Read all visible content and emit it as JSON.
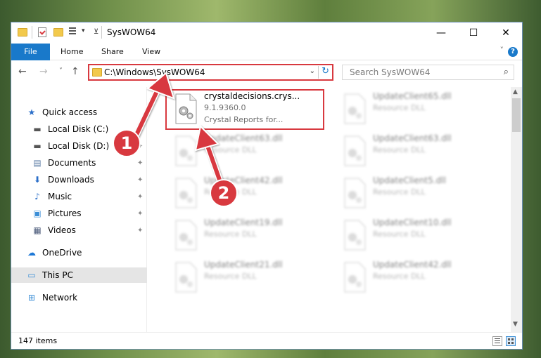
{
  "window": {
    "title": "SysWOW64"
  },
  "window_controls": {
    "minimize": "—",
    "maximize": "☐",
    "close": "✕"
  },
  "ribbon": {
    "tabs": [
      "File",
      "Home",
      "Share",
      "View"
    ],
    "help": "?",
    "collapse": "˅"
  },
  "nav": {
    "back": "←",
    "forward": "→",
    "recent": "˅",
    "up": "↑"
  },
  "address": {
    "path": "C:\\Windows\\SysWOW64",
    "dropdown": "⌄",
    "refresh": "↻"
  },
  "search": {
    "placeholder": "Search SysWOW64",
    "icon": "⌕"
  },
  "sidebar": {
    "items": [
      {
        "label": "Quick access",
        "icon": "star-icon",
        "glyph": "★",
        "color": "#2b6fc9",
        "pinned": false
      },
      {
        "label": "Local Disk (C:)",
        "icon": "drive-icon",
        "glyph": "▬",
        "color": "#555555",
        "pinned": true
      },
      {
        "label": "Local Disk (D:)",
        "icon": "drive-icon",
        "glyph": "▬",
        "color": "#555555",
        "pinned": true
      },
      {
        "label": "Documents",
        "icon": "documents-icon",
        "glyph": "▤",
        "color": "#5d7da6",
        "pinned": true
      },
      {
        "label": "Downloads",
        "icon": "download-icon",
        "glyph": "⬇",
        "color": "#2b6fc9",
        "pinned": true
      },
      {
        "label": "Music",
        "icon": "music-icon",
        "glyph": "♪",
        "color": "#2b6fc9",
        "pinned": true
      },
      {
        "label": "Pictures",
        "icon": "pictures-icon",
        "glyph": "▣",
        "color": "#3b8ed6",
        "pinned": true
      },
      {
        "label": "Videos",
        "icon": "videos-icon",
        "glyph": "▦",
        "color": "#4b5a7a",
        "pinned": true
      },
      {
        "label": "OneDrive",
        "icon": "onedrive-icon",
        "glyph": "☁",
        "color": "#1e78d6",
        "pinned": false
      },
      {
        "label": "This PC",
        "icon": "computer-icon",
        "glyph": "▭",
        "color": "#3b8ed6",
        "pinned": false,
        "selected": true
      },
      {
        "label": "Network",
        "icon": "network-icon",
        "glyph": "⊞",
        "color": "#3b8ed6",
        "pinned": false
      }
    ],
    "pin_glyph": "📌"
  },
  "files": {
    "highlighted": {
      "name": "crystaldecisions.crys...",
      "version": "9.1.9360.0",
      "desc": "Crystal Reports for..."
    },
    "blurred": [
      {
        "name": "UpdateClient65.dll",
        "desc": "Resource DLL"
      },
      {
        "name": "UpdateClient63.dll",
        "desc": "Resource DLL"
      },
      {
        "name": "UpdateClient63.dll",
        "desc": "Resource DLL"
      },
      {
        "name": "UpdateClient42.dll",
        "desc": "Resource DLL"
      },
      {
        "name": "UpdateClient5.dll",
        "desc": "Resource DLL"
      },
      {
        "name": "UpdateClient19.dll",
        "desc": "Resource DLL"
      },
      {
        "name": "UpdateClient10.dll",
        "desc": "Resource DLL"
      },
      {
        "name": "UpdateClient21.dll",
        "desc": "Resource DLL"
      },
      {
        "name": "UpdateClient42.dll",
        "desc": "Resource DLL"
      }
    ]
  },
  "status": {
    "count": "147 items"
  },
  "callouts": [
    "1",
    "2"
  ],
  "colors": {
    "accent": "#1979ca",
    "highlight": "#d8393f"
  }
}
